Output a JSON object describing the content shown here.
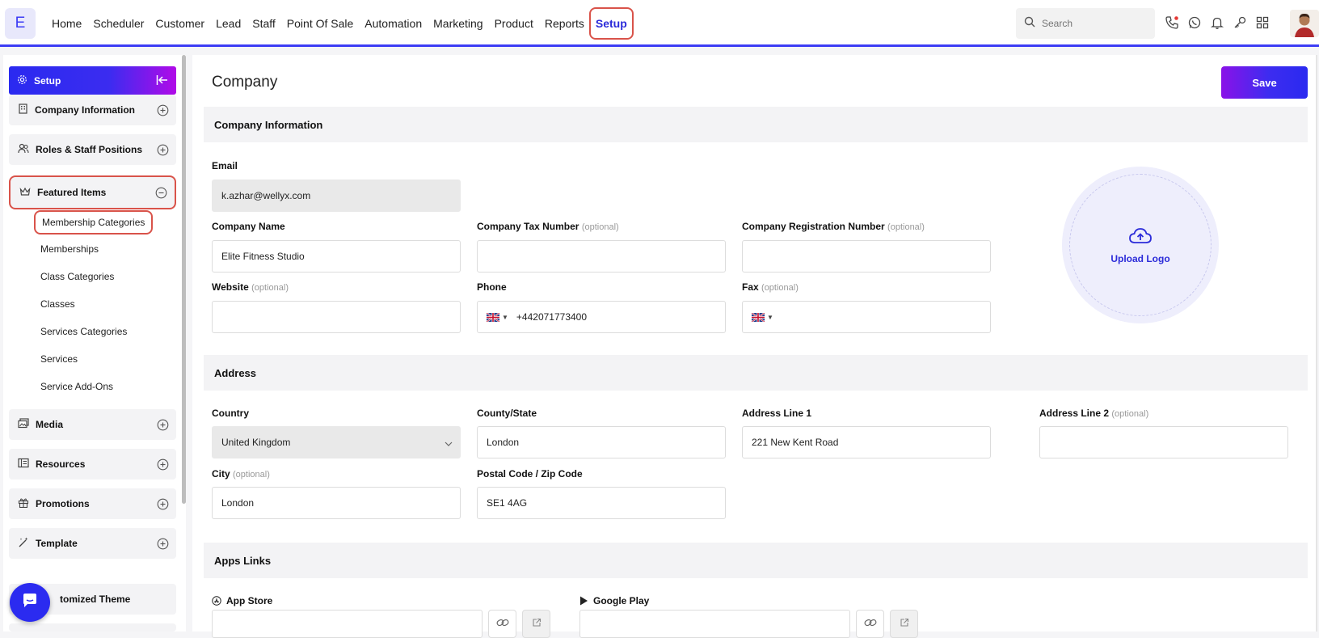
{
  "app": {
    "logo_letter": "E"
  },
  "nav": {
    "items": [
      "Home",
      "Scheduler",
      "Customer",
      "Lead",
      "Staff",
      "Point Of Sale",
      "Automation",
      "Marketing",
      "Product",
      "Reports"
    ],
    "active": "Setup"
  },
  "search": {
    "placeholder": "Search"
  },
  "top_icons": [
    "phone-icon",
    "whatsapp-icon",
    "bell-icon",
    "key-icon",
    "apps-grid-icon"
  ],
  "sidebar": {
    "header": "Setup",
    "sections": {
      "company_information": "Company Information",
      "roles": "Roles & Staff Positions",
      "featured_items": "Featured Items",
      "media": "Media",
      "resources": "Resources",
      "promotions": "Promotions",
      "template": "Template",
      "customized_theme": "tomized Theme"
    },
    "featured_sub_items": [
      "Membership Categories",
      "Memberships",
      "Class Categories",
      "Classes",
      "Services Categories",
      "Services",
      "Service Add-Ons"
    ]
  },
  "main": {
    "title": "Company",
    "save_label": "Save",
    "company_info_title": "Company Information",
    "email_label": "Email",
    "email_value": "k.azhar@wellyx.com",
    "company_name_label": "Company Name",
    "company_name_value": "Elite  Fitness Studio",
    "tax_label": "Company Tax Number",
    "registration_label": "Company Registration Number",
    "website_label": "Website",
    "phone_label": "Phone",
    "phone_value": "+442071773400",
    "fax_label": "Fax",
    "optional": "(optional)",
    "upload_logo": "Upload Logo",
    "address_title": "Address",
    "country_label": "Country",
    "country_value": "United Kingdom",
    "county_label": "County/State",
    "county_value": "London",
    "address1_label": "Address Line 1",
    "address1_value": "221 New Kent Road",
    "address2_label": "Address Line 2",
    "city_label": "City",
    "city_value": "London",
    "postal_label": "Postal Code / Zip Code",
    "postal_value": "SE1 4AG",
    "apps_title": "Apps Links",
    "app_store_label": "App Store",
    "google_play_label": "Google Play"
  },
  "colors": {
    "accent": "#2b2bd9",
    "highlight": "#d9534a",
    "gradient_end": "#b10ae8"
  }
}
